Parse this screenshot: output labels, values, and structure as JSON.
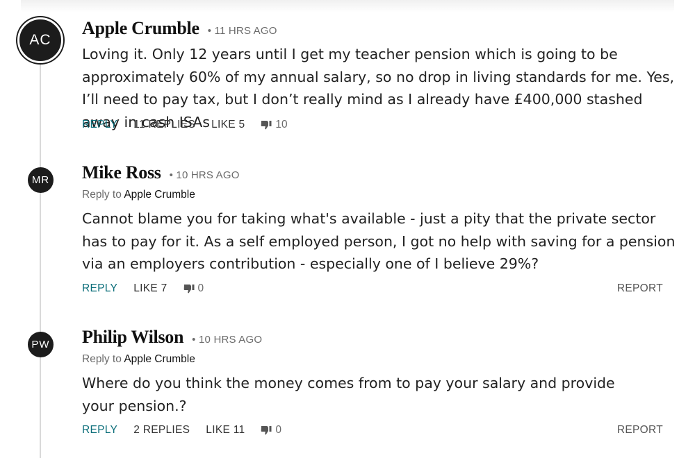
{
  "comments": [
    {
      "initials": "AC",
      "author": "Apple Crumble",
      "time": "• 11 HRS AGO",
      "reply_to_label": "",
      "reply_to_name": "",
      "body": "Loving it. Only 12 years until I get my teacher pension which is going to be approximately 60% of my annual salary, so no drop in living standards for me. Yes, I’ll need to pay tax, but I don’t really mind as I already have £400,000 stashed away in cash ISAs",
      "reply_label": "REPLY",
      "replies_label": "11 REPLIES",
      "like_label": "LIKE 5",
      "dislike_count": "10",
      "report_label": ""
    },
    {
      "initials": "MR",
      "author": "Mike Ross",
      "time": "• 10 HRS AGO",
      "reply_to_label": "Reply to",
      "reply_to_name": "Apple Crumble",
      "body": "Cannot blame you for taking what's available - just a pity that the private sector has to pay for it. As a self employed person, I got no help with saving for a pension via an employers contribution - especially one of I believe 29%?",
      "reply_label": "REPLY",
      "replies_label": "",
      "like_label": "LIKE 7",
      "dislike_count": "0",
      "report_label": "REPORT"
    },
    {
      "initials": "PW",
      "author": "Philip Wilson",
      "time": "• 10 HRS AGO",
      "reply_to_label": "Reply to",
      "reply_to_name": "Apple Crumble",
      "body": "Where do you think the money comes from to pay your salary and provide your pension.?",
      "reply_label": "REPLY",
      "replies_label": "2 REPLIES",
      "like_label": "LIKE 11",
      "dislike_count": "0",
      "report_label": "REPORT"
    }
  ],
  "icons": {
    "dislike": "thumbs-down-icon"
  },
  "colors": {
    "reply_accent": "#0b6e7a",
    "avatar_bg": "#1c1c1c",
    "thread_line": "#d9d9d9"
  }
}
